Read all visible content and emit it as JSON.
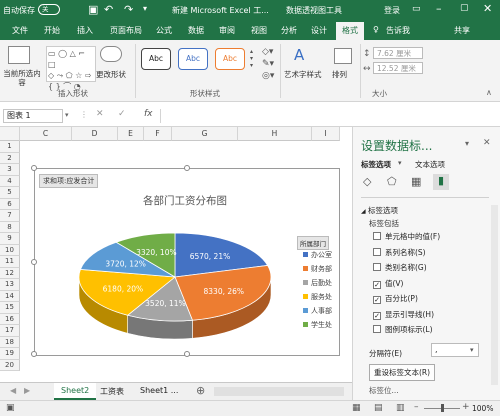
{
  "title_bar": {
    "autosave": "自动保存",
    "autosave_state": "关",
    "title": "新建 Microsoft Excel 工...",
    "context": "数据透视图工具",
    "login": "登录"
  },
  "tabs": [
    "文件",
    "开始",
    "插入",
    "页面布局",
    "公式",
    "数据",
    "审阅",
    "视图",
    "分析",
    "设计",
    "格式"
  ],
  "active_tab": "格式",
  "tell_me": "告诉我",
  "share": "共享",
  "ribbon": {
    "current_selection": "当前所选内容",
    "change_shape": "更改形状",
    "insert_shapes_group": "插入形状",
    "shape_styles": [
      "Abc",
      "Abc",
      "Abc"
    ],
    "shape_styles_group": "形状样式",
    "wordart": "艺术字样式",
    "arrange": "排列",
    "height": "7.62 厘米",
    "width": "12.52 厘米",
    "size_group": "大小"
  },
  "formula_bar": {
    "name_box": "图表 1",
    "fx": "fx"
  },
  "columns": [
    "C",
    "D",
    "E",
    "F",
    "G",
    "H",
    "I"
  ],
  "rows": [
    "1",
    "2",
    "3",
    "4",
    "5",
    "6",
    "7",
    "8",
    "9",
    "10",
    "11",
    "12",
    "13",
    "14",
    "15",
    "16",
    "17",
    "18",
    "19",
    "20"
  ],
  "chart": {
    "field_button": "求和项:应发合计",
    "title": "各部门工资分布图",
    "legend_title": "所属部门",
    "legend": [
      {
        "label": "办公室",
        "color": "#4472c4"
      },
      {
        "label": "财务部",
        "color": "#ed7d31"
      },
      {
        "label": "后勤处",
        "color": "#a5a5a5"
      },
      {
        "label": "服务处",
        "color": "#ffc000"
      },
      {
        "label": "人事部",
        "color": "#5b9bd5"
      },
      {
        "label": "学生处",
        "color": "#70ad47"
      }
    ],
    "labels": [
      "6570, 21%",
      "8330, 26%",
      "3520, 11%",
      "6180, 20%",
      "3720, 12%",
      "3320, 10%"
    ]
  },
  "chart_data": {
    "type": "pie",
    "title": "各部门工资分布图",
    "legend_title": "所属部门",
    "categories": [
      "办公室",
      "财务部",
      "后勤处",
      "服务处",
      "人事部",
      "学生处"
    ],
    "values": [
      6570,
      8330,
      3520,
      6180,
      3720,
      3320
    ],
    "percent": [
      21,
      26,
      11,
      20,
      12,
      10
    ],
    "colors": [
      "#4472c4",
      "#ed7d31",
      "#a5a5a5",
      "#ffc000",
      "#5b9bd5",
      "#70ad47"
    ],
    "legend_position": "right"
  },
  "pane": {
    "title": "设置数据标...",
    "tab_options": "标签选项",
    "tab_text": "文本选项",
    "section": "标签选项",
    "contains": "标签包括",
    "options": [
      {
        "label": "单元格中的值(F)",
        "checked": false
      },
      {
        "label": "系列名称(S)",
        "checked": false
      },
      {
        "label": "类别名称(G)",
        "checked": false
      },
      {
        "label": "值(V)",
        "checked": true
      },
      {
        "label": "百分比(P)",
        "checked": true
      },
      {
        "label": "显示引导线(H)",
        "checked": true
      },
      {
        "label": "图例项标示(L)",
        "checked": false
      }
    ],
    "separator": "分隔符(E)",
    "separator_value": ",",
    "reset": "重设标签文本(R)",
    "position_partial": "标签位..."
  },
  "sheets": [
    "Sheet2",
    "工资表",
    "Sheet1 ..."
  ],
  "active_sheet": "Sheet2",
  "status": {
    "zoom": "100%"
  }
}
